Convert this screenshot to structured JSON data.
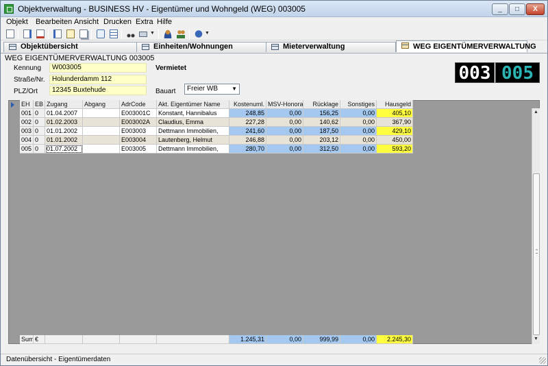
{
  "window": {
    "title": "Objektverwaltung - BUSINESS HV - Eigentümer und Wohngeld (WEG) 003005",
    "min_label": "_",
    "max_label": "□",
    "close_label": "X"
  },
  "menu": [
    "Objekt",
    "Bearbeiten",
    "Ansicht",
    "Drucken",
    "Extra",
    "Hilfe"
  ],
  "toolbar_icons": [
    "new-document-icon",
    "edit-document-icon",
    "delete-document-icon",
    "properties-icon",
    "notes-icon",
    "copy-icon",
    "comment-icon",
    "table-icon",
    "binoculars-icon",
    "print-icon",
    "person-icon",
    "persons-icon",
    "help-icon"
  ],
  "tabs": [
    {
      "label": "Objektübersicht",
      "active": false
    },
    {
      "label": "Einheiten/Wohnungen",
      "active": false
    },
    {
      "label": "Mieterverwaltung",
      "active": false
    },
    {
      "label": "WEG EIGENTÜMERVERWALTUNG",
      "active": true
    }
  ],
  "header": {
    "heading": "WEG EIGENTÜMERVERWALTUNG 003005",
    "kennung_label": "Kennung",
    "kennung_value": "W003005",
    "strasse_label": "Straße/Nr.",
    "strasse_value": "Holunderdamm 112",
    "plz_label": "PLZ/Ort",
    "plz_value": "12345 Buxtehude",
    "status": "Vermietet",
    "bauart_label": "Bauart",
    "bauart_value": "Freier WB",
    "object_number_a": "003",
    "object_number_b": "005"
  },
  "colors": {
    "accent_teal": "#2bb5b5",
    "cost_blue": "#a4c8f0",
    "hausgeld_yellow": "#ffff40"
  },
  "table": {
    "columns": [
      "EH",
      "EB",
      "Zugang",
      "Abgang",
      "AdrCode",
      "Akt. Eigentümer Name",
      "Kostenuml.",
      "MSV-Honorar",
      "Rücklage",
      "Sonstiges",
      "Hausgeld"
    ],
    "rows": [
      [
        "001",
        "0",
        "01.04.2007",
        "",
        "E003001C",
        "Konstant, Hannibalus",
        "248,85",
        "0,00",
        "156,25",
        "0,00",
        "405,10"
      ],
      [
        "002",
        "0",
        "01.02.2003",
        "",
        "E003002A",
        "Claudius, Emma",
        "227,28",
        "0,00",
        "140,62",
        "0,00",
        "367,90"
      ],
      [
        "003",
        "0",
        "01.01.2002",
        "",
        "E003003",
        "Dettmann Immobilien,",
        "241,60",
        "0,00",
        "187,50",
        "0,00",
        "429,10"
      ],
      [
        "004",
        "0",
        "01.01.2002",
        "",
        "E003004",
        "Lautenberg, Helmut",
        "246,88",
        "0,00",
        "203,12",
        "0,00",
        "450,00"
      ],
      [
        "005",
        "0",
        "01.07.2002",
        "",
        "E003005",
        "Dettmann Immobilien,",
        "280,70",
        "0,00",
        "312,50",
        "0,00",
        "593,20"
      ]
    ],
    "sum": {
      "label": "Sum",
      "currency": "€",
      "values": [
        "1.245,31",
        "0,00",
        "999,99",
        "0,00",
        "2.245,30"
      ]
    }
  },
  "status_bar": "Datenübersicht - Eigentümerdaten"
}
